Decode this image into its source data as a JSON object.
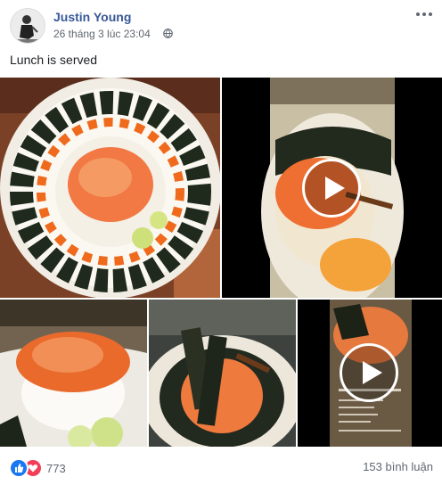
{
  "post": {
    "author": "Justin Young",
    "timestamp": "26 tháng 3 lúc 23:04",
    "text": "Lunch is served"
  },
  "media": [
    {
      "kind": "photo"
    },
    {
      "kind": "video"
    },
    {
      "kind": "photo"
    },
    {
      "kind": "photo"
    },
    {
      "kind": "video"
    }
  ],
  "footer": {
    "reaction_count": "773",
    "comments_label": "153 bình luận",
    "reactions": [
      "like-icon",
      "love-icon"
    ]
  },
  "colors": {
    "link": "#385898",
    "like": "#1877f2",
    "love": "#f33e58",
    "secondary_text": "#606770"
  }
}
